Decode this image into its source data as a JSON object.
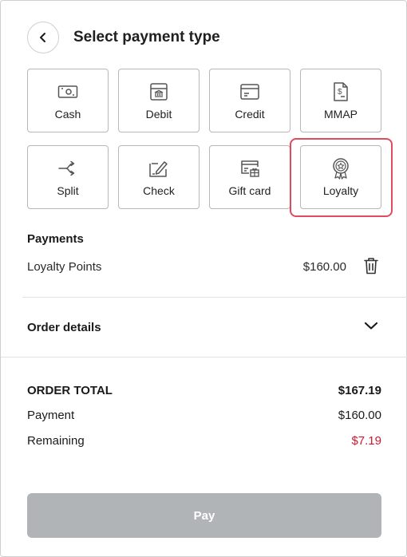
{
  "header": {
    "title": "Select payment type"
  },
  "payment_types": [
    {
      "label": "Cash",
      "icon": "cash-icon"
    },
    {
      "label": "Debit",
      "icon": "bank-card-icon"
    },
    {
      "label": "Credit",
      "icon": "credit-card-icon"
    },
    {
      "label": "MMAP",
      "icon": "dollar-document-icon"
    },
    {
      "label": "Split",
      "icon": "split-arrows-icon"
    },
    {
      "label": "Check",
      "icon": "check-pen-icon"
    },
    {
      "label": "Gift card",
      "icon": "gift-card-icon"
    },
    {
      "label": "Loyalty",
      "icon": "award-badge-icon",
      "selected": true
    }
  ],
  "payments": {
    "heading": "Payments",
    "items": [
      {
        "name": "Loyalty Points",
        "amount": "$160.00"
      }
    ]
  },
  "order_details": {
    "label": "Order details"
  },
  "totals": {
    "order_total_label": "ORDER TOTAL",
    "order_total_value": "$167.19",
    "payment_label": "Payment",
    "payment_value": "$160.00",
    "remaining_label": "Remaining",
    "remaining_value": "$7.19"
  },
  "pay_button": {
    "label": "Pay"
  },
  "colors": {
    "selection_outline": "#e04b5e",
    "remaining": "#d0182e",
    "pay_disabled": "#b0b4b7"
  }
}
